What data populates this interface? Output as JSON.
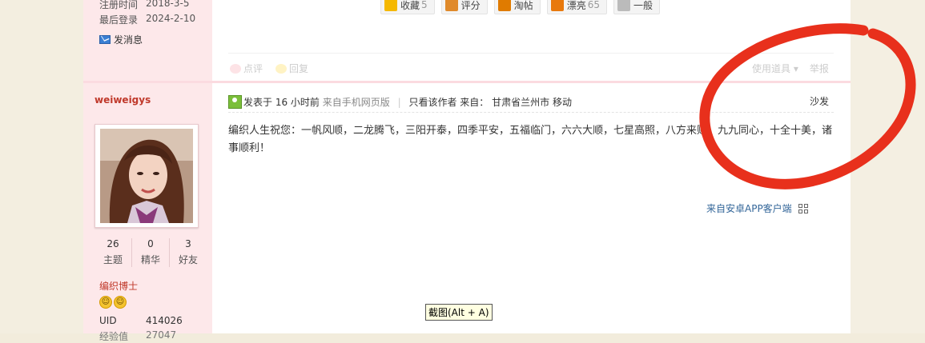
{
  "profile_top": {
    "reg_label": "注册时间",
    "reg_value": "2018-3-5",
    "last_label": "最后登录",
    "last_value": "2024-2-10",
    "send_msg": "发消息"
  },
  "actions": [
    {
      "label": "收藏",
      "count": "5",
      "color": "#f5b800"
    },
    {
      "label": "评分",
      "count": "",
      "color": "#e08a2b"
    },
    {
      "label": "淘帖",
      "count": "",
      "color": "#e07b00"
    },
    {
      "label": "漂亮",
      "count": "65",
      "color": "#e8790d"
    },
    {
      "label": "一般",
      "count": "",
      "color": "#9a9a9a"
    }
  ],
  "toolbar": {
    "comment": "点评",
    "reply": "回复",
    "tools": "使用道具 ▾",
    "report": "举报"
  },
  "user": {
    "name": "weiweigys",
    "stats": [
      {
        "num": "26",
        "label": "主题"
      },
      {
        "num": "0",
        "label": "精华"
      },
      {
        "num": "3",
        "label": "好友"
      }
    ],
    "rank": "编织博士",
    "uid_label": "UID",
    "uid_value": "414026",
    "next_label": "经验值",
    "next_value": "27047"
  },
  "post": {
    "posted": "发表于 16 小时前",
    "source": "来自手机网页版",
    "only_author": "只看该作者",
    "from_label": "来自：",
    "location": "甘肃省兰州市 移动",
    "floor": "沙发",
    "body": "编织人生祝您：一帆风顺，二龙腾飞，三阳开泰，四季平安，五福临门，六六大顺，七星高照，八方来财，九九同心，十全十美，诸事顺利！",
    "from_app": "来自安卓APP客户端"
  },
  "tooltip": "截图(Alt + A)",
  "colors": {
    "accent": "#c0392b",
    "sidebar": "#fde8ea",
    "annotation": "#e8301c"
  }
}
